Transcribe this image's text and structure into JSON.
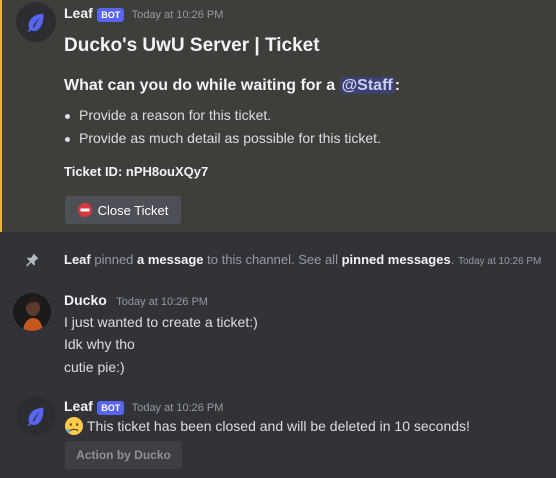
{
  "message1": {
    "author": "Leaf",
    "bot_badge": "BOT",
    "timestamp": "Today at 10:26 PM",
    "title": "Ducko's UwU Server | Ticket",
    "heading_prefix": "What can you do while waiting for a ",
    "mention": "@Staff",
    "heading_suffix": ":",
    "bullets": [
      "Provide a reason for this ticket.",
      "Provide as much detail as possible for this ticket."
    ],
    "ticket_id": "Ticket ID: nPH8ouXQy7",
    "close_button": "Close Ticket",
    "highlight_color": "#f0b232"
  },
  "system": {
    "actor": "Leaf",
    "pinned": "pinned",
    "a_message": "a message",
    "to_channel": "to this channel. See all",
    "pinned_messages": "pinned messages",
    "period": ".",
    "timestamp": "Today at 10:26 PM"
  },
  "message2": {
    "author": "Ducko",
    "timestamp": "Today at 10:26 PM",
    "lines": [
      "I just wanted to create a ticket:)",
      "Idk why tho",
      "cutie pie:)"
    ]
  },
  "message3": {
    "author": "Leaf",
    "bot_badge": "BOT",
    "timestamp": "Today at 10:26 PM",
    "text": "This ticket has been closed and will be deleted in 10 seconds!",
    "action_button": "Action by Ducko"
  },
  "icons": {
    "leaf": "leaf-icon",
    "no_entry": "no-entry-icon",
    "pin": "pin-icon",
    "sad_face": "sad-emoji-icon"
  },
  "colors": {
    "accent": "#5865f2",
    "leaf": "#5865f2",
    "close": "#da373c"
  }
}
